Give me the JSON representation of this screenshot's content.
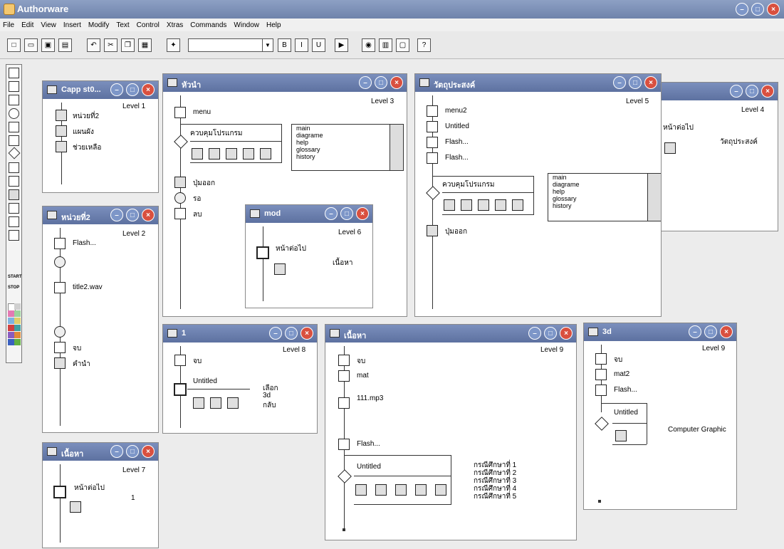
{
  "app": {
    "title": "Authorware"
  },
  "menu": [
    "File",
    "Edit",
    "View",
    "Insert",
    "Modify",
    "Text",
    "Control",
    "Xtras",
    "Commands",
    "Window",
    "Help"
  ],
  "toolbar": {
    "font_buttons": [
      "B",
      "I",
      "U"
    ]
  },
  "windows": {
    "w1": {
      "title": "Capp st0...",
      "level": "Level 1",
      "icons": [
        "หน่วยที่2",
        "แผนผัง",
        "ช่วยเหลือ"
      ]
    },
    "w2": {
      "title": "หน่วยที่2",
      "level": "Level 2",
      "icons": [
        "Flash...",
        "title2.wav",
        "จบ",
        "คำนำ"
      ]
    },
    "w3": {
      "title": "หัวนำ",
      "level": "Level 3",
      "icons": [
        "menu",
        "ควบคุมโปรแกรม",
        "ปุ่มออก",
        "รอ",
        "ลบ"
      ],
      "list": [
        "main",
        "diagrame",
        "help",
        "glossary",
        "history"
      ]
    },
    "w4": {
      "title": "วัตถุประสงค์",
      "level": "Level 5",
      "icons": [
        "menu2",
        "Untitled",
        "Flash...",
        "Flash...",
        "ควบคุมโปรแกรม",
        "ปุ่มออก"
      ],
      "list": [
        "main",
        "diagrame",
        "help",
        "glossary",
        "history"
      ]
    },
    "w5": {
      "title": "",
      "level": "Level 4",
      "icons": [
        "หน้าต่อไป",
        "วัตถุประสงค์"
      ]
    },
    "w6": {
      "title": "mod",
      "level": "Level 6",
      "icons": [
        "หน้าต่อไป",
        "เนื้อหา"
      ]
    },
    "w7": {
      "title": "1",
      "level": "Level 8",
      "icons": [
        "จบ",
        "Untitled"
      ],
      "choices": [
        "เลือก",
        "3d",
        "กลับ"
      ]
    },
    "w8": {
      "title": "เนื้อหา",
      "level": "Level 7",
      "icons": [
        "หน้าต่อไป",
        "1"
      ]
    },
    "w9": {
      "title": "เนื้อหา",
      "level": "Level 9",
      "icons": [
        "จบ",
        "mat",
        "111.mp3",
        "Flash...",
        "Untitled"
      ],
      "cases": [
        "กรณีศึกษาที่ 1",
        "กรณีศึกษาที่ 2",
        "กรณีศึกษาที่ 3",
        "กรณีศึกษาที่ 4",
        "กรณีศึกษาที่ 5"
      ]
    },
    "w10": {
      "title": "3d",
      "level": "Level 9",
      "icons": [
        "จบ",
        "mat2",
        "Flash...",
        "Untitled",
        "Computer Graphic"
      ]
    }
  }
}
